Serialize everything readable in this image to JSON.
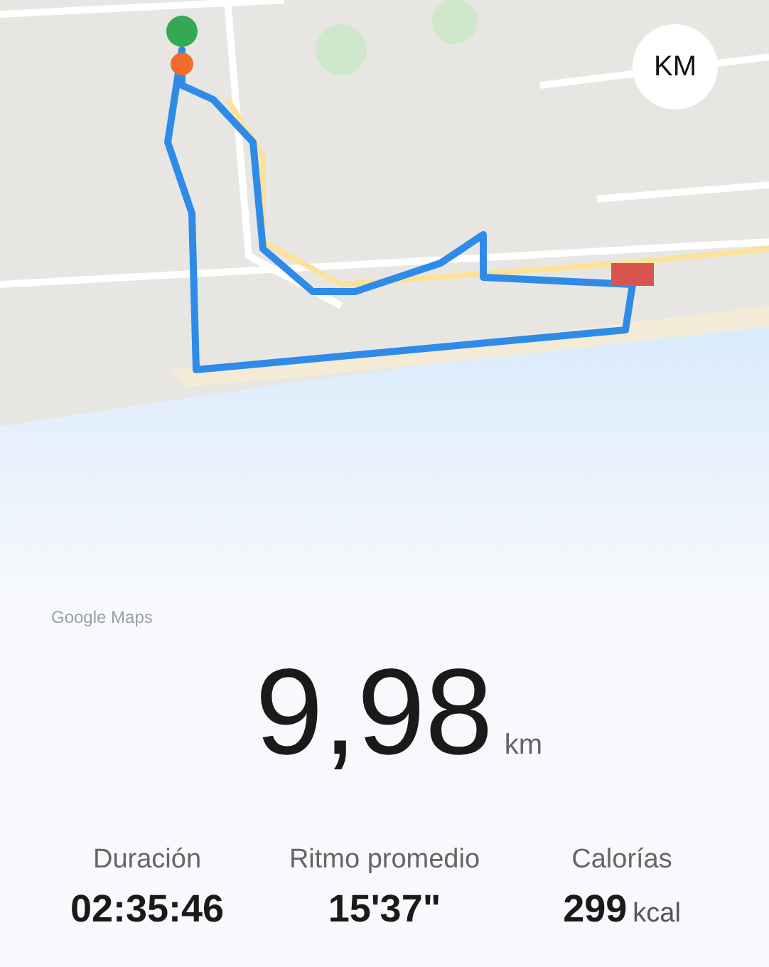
{
  "map": {
    "kind": "picture",
    "unit_button": "KM",
    "attribution": "Google Maps"
  },
  "distance": {
    "value": "9,98",
    "unit": "km"
  },
  "stats": [
    {
      "label": "Duración",
      "value": "02:35:46"
    },
    {
      "label": "Ritmo promedio",
      "value": "15'37\""
    },
    {
      "label": "Calorías",
      "value": "299",
      "unit": "kcal"
    }
  ]
}
